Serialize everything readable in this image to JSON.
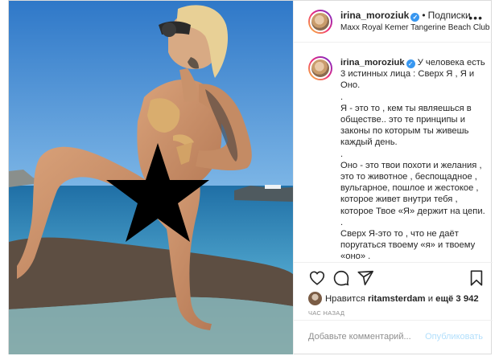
{
  "header": {
    "username": "irina_moroziuk",
    "separator": "•",
    "follow_label": "Подписки",
    "location": "Maxx Royal Kemer Tangerine Beach Club",
    "more_label": "•••"
  },
  "caption": {
    "username": "irina_moroziuk",
    "text": "У человека есть 3 истинных лица : Сверх Я , Я и Оно.\n.\nЯ - это то , кем ты являешься в обществе.. это те принципы и законы по которым ты живешь каждый день.\n.\nОно - это твои похоти и желания , это то животное , беспощадное , вульгарное, пошлое и жестокое , которое живет внутри тебя , которое Твое «Я» держит на цепи.\n.\nСверх Я-это то , что не даёт поругаться твоему «я» и твоему «оно» .\n.\nХу*вых людей нет , есть те, у"
  },
  "actions": {
    "like_icon": "heart-icon",
    "comment_icon": "comment-icon",
    "share_icon": "share-icon",
    "save_icon": "bookmark-icon",
    "likes_prefix": "Нравится ",
    "likes_user": "ritamsterdam",
    "likes_middle": " и ",
    "likes_count": "ещё 3 942",
    "time": "ЧАС НАЗАД"
  },
  "comment": {
    "placeholder": "Добавьте комментарий...",
    "post_label": "Опубликовать"
  },
  "colors": {
    "accent": "#3897f0",
    "post_disabled": "#b2dffc",
    "border": "#dbdbdb"
  }
}
